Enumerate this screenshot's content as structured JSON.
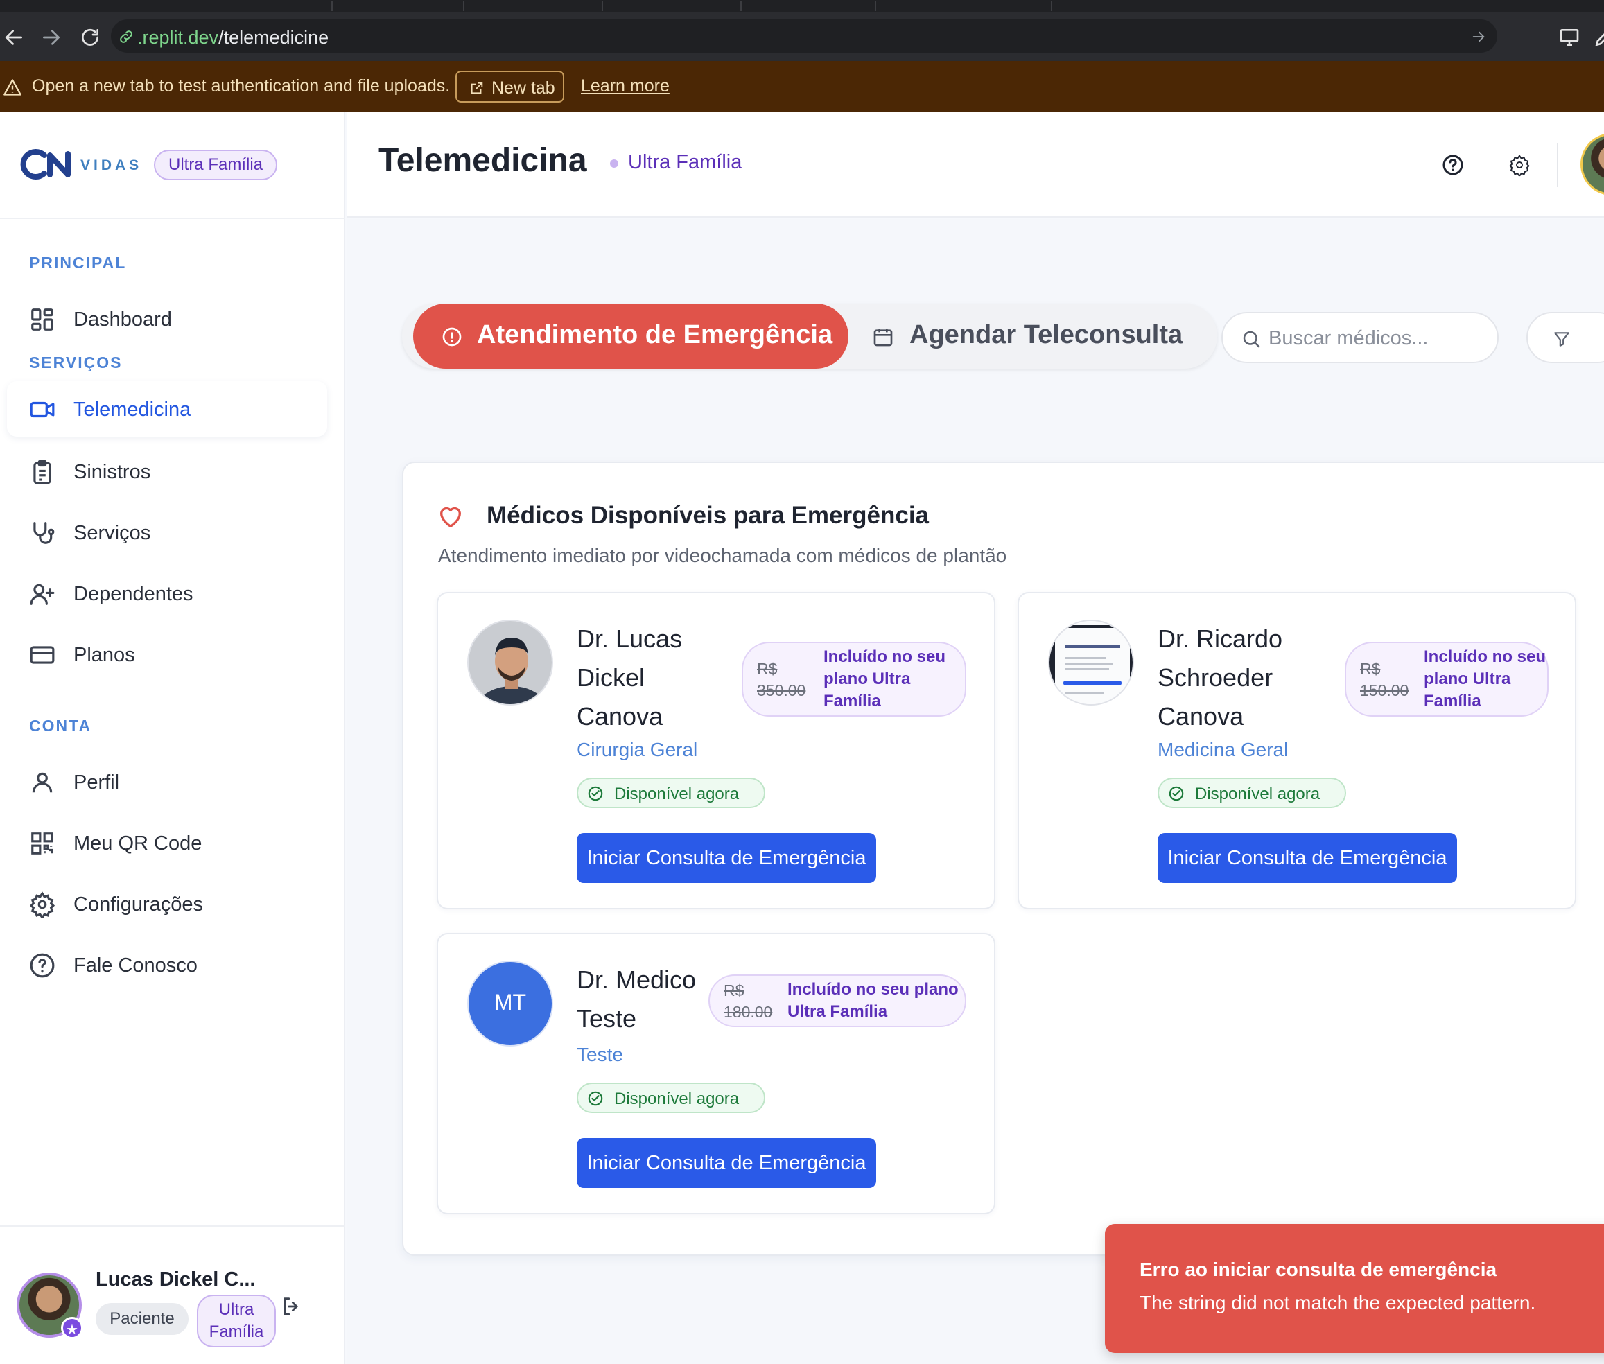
{
  "browser": {
    "url_host": ".replit.dev",
    "url_path": "/telemedicine"
  },
  "banner": {
    "message": "Open a new tab to test authentication and file uploads.",
    "new_tab_label": "New tab",
    "learn_more_label": "Learn more"
  },
  "sidebar": {
    "logo_text": "VIDAS",
    "plan_badge": "Ultra Família",
    "sections": {
      "principal": "PRINCIPAL",
      "servicos": "SERVIÇOS",
      "conta": "CONTA"
    },
    "items": [
      {
        "label": "Dashboard",
        "icon": "dashboard-icon"
      },
      {
        "label": "Telemedicina",
        "icon": "video-icon",
        "active": true
      },
      {
        "label": "Sinistros",
        "icon": "clipboard-icon"
      },
      {
        "label": "Serviços",
        "icon": "stethoscope-icon"
      },
      {
        "label": "Dependentes",
        "icon": "user-plus-icon"
      },
      {
        "label": "Planos",
        "icon": "credit-card-icon"
      },
      {
        "label": "Perfil",
        "icon": "user-icon"
      },
      {
        "label": "Meu QR Code",
        "icon": "qr-code-icon"
      },
      {
        "label": "Configurações",
        "icon": "gear-icon"
      },
      {
        "label": "Fale Conosco",
        "icon": "help-circle-icon"
      }
    ],
    "user": {
      "name": "Lucas Dickel C...",
      "role": "Paciente",
      "plan": "Ultra Família"
    }
  },
  "header": {
    "title": "Telemedicina",
    "plan": "Ultra Família"
  },
  "tabs": {
    "emergency": "Atendimento de Emergência",
    "schedule": "Agendar Teleconsulta"
  },
  "search": {
    "placeholder": "Buscar médicos..."
  },
  "panel": {
    "title": "Médicos Disponíveis para Emergência",
    "subtitle": "Atendimento imediato por videochamada com médicos de plantão"
  },
  "doctors": [
    {
      "name": "Dr. Lucas Dickel Canova",
      "specialty": "Cirurgia Geral",
      "price_currency": "R$",
      "price_old": "350.00",
      "included": "Incluído no seu plano Ultra Família",
      "availability": "Disponível agora",
      "action": "Iniciar Consulta de Emergência"
    },
    {
      "name": "Dr. Ricardo Schroeder Canova",
      "specialty": "Medicina Geral",
      "price_currency": "R$",
      "price_old": "150.00",
      "included": "Incluído no seu plano Ultra Família",
      "availability": "Disponível agora",
      "action": "Iniciar Consulta de Emergência"
    },
    {
      "name": "Dr. Medico Teste",
      "initials": "MT",
      "specialty": "Teste",
      "price_currency": "R$",
      "price_old": "180.00",
      "included": "Incluído no seu plano Ultra Família",
      "availability": "Disponível agora",
      "action": "Iniciar Consulta de Emergência"
    }
  ],
  "toast": {
    "title": "Erro ao iniciar consulta de emergência",
    "message": "The string did not match the expected pattern."
  },
  "colors": {
    "primary": "#2a5ae8",
    "emergency": "#e0534a",
    "plan_purple": "#5b2fb8",
    "available_green": "#1d7a3a",
    "banner_bg": "#4b2705"
  }
}
